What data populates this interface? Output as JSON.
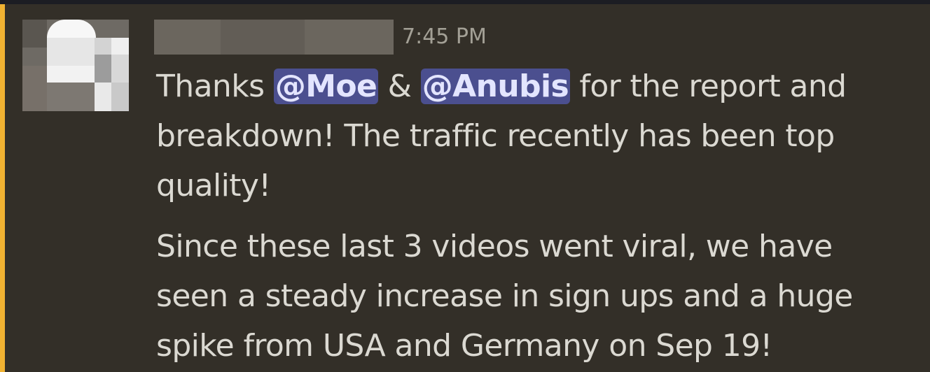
{
  "message": {
    "timestamp": "7:45 PM",
    "paragraph_1": {
      "prefix": "Thanks ",
      "mention_1": "@Moe",
      "separator": " & ",
      "mention_2": "@Anubis",
      "suffix": " for the report and breakdown! The traffic recently has been top quality!"
    },
    "paragraph_2": "Since these last 3 videos went viral, we have seen a steady increase in sign ups and a huge spike from USA and Germany on Sep 19!"
  },
  "colors": {
    "background": "#332f28",
    "mention_stripe": "#f0b232",
    "mention_highlight": "#4b4f8f",
    "text": "#dbd9d2",
    "timestamp": "#a3a096"
  }
}
